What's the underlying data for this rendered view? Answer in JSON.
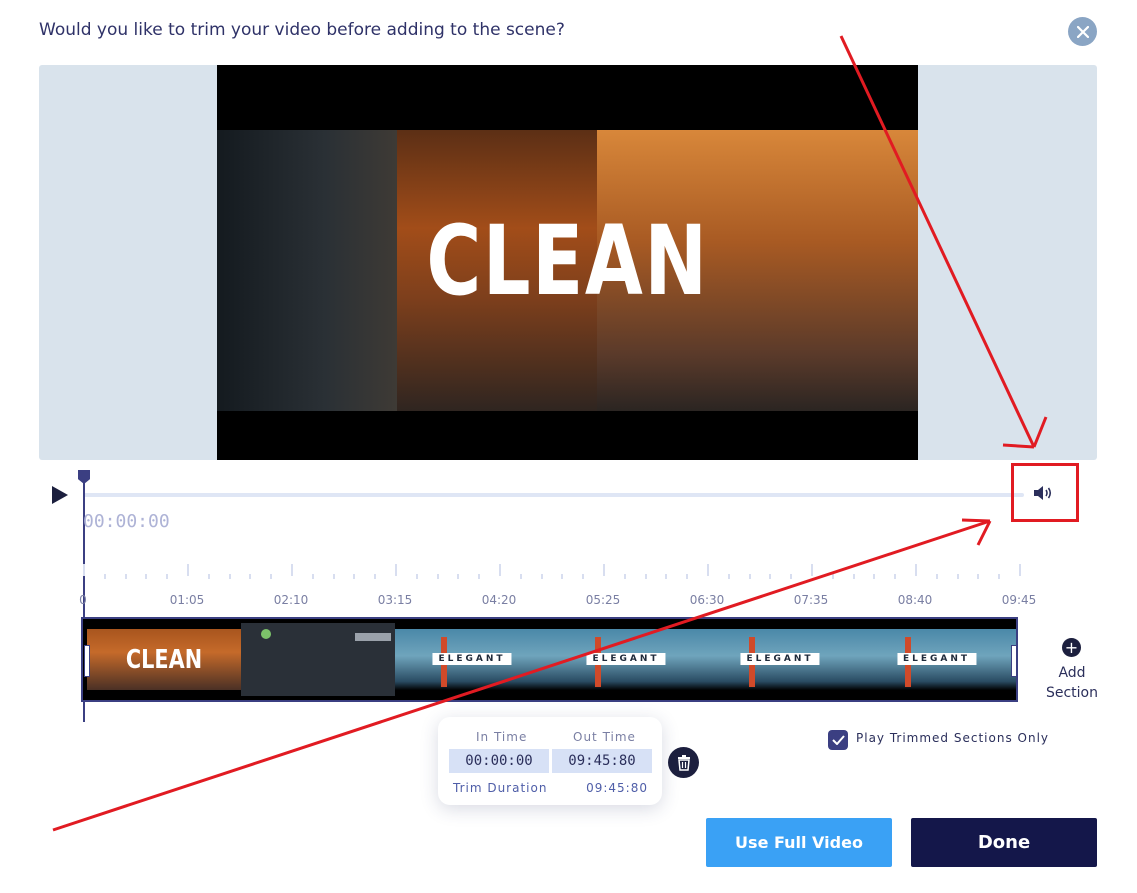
{
  "dialog": {
    "title": "Would you like to trim your video before adding to the scene?"
  },
  "video": {
    "title_text": "CLEAN"
  },
  "player": {
    "current_time": "00:00:00"
  },
  "timeline": {
    "tick_labels": [
      "0",
      "01:05",
      "02:10",
      "03:15",
      "04:20",
      "05:25",
      "06:30",
      "07:35",
      "08:40",
      "09:45"
    ]
  },
  "filmstrip": {
    "frame_1_text": "CLEAN",
    "elegant_text": "ELEGANT"
  },
  "add_section": {
    "label_line1": "Add",
    "label_line2": "Section"
  },
  "trim": {
    "in_label": "In Time",
    "out_label": "Out Time",
    "in_value": "00:00:00",
    "out_value": "09:45:80",
    "duration_label": "Trim Duration",
    "duration_value": "09:45:80"
  },
  "options": {
    "play_trimmed_label": "Play Trimmed Sections Only",
    "play_trimmed_checked": true
  },
  "buttons": {
    "use_full": "Use Full Video",
    "done": "Done"
  },
  "colors": {
    "accent_blue": "#3aa1f5",
    "done_navy": "#14174a",
    "annotation_red": "#e11b22"
  },
  "icons": [
    "close-icon",
    "play-icon",
    "volume-icon",
    "plus-icon",
    "trash-icon",
    "check-icon"
  ]
}
